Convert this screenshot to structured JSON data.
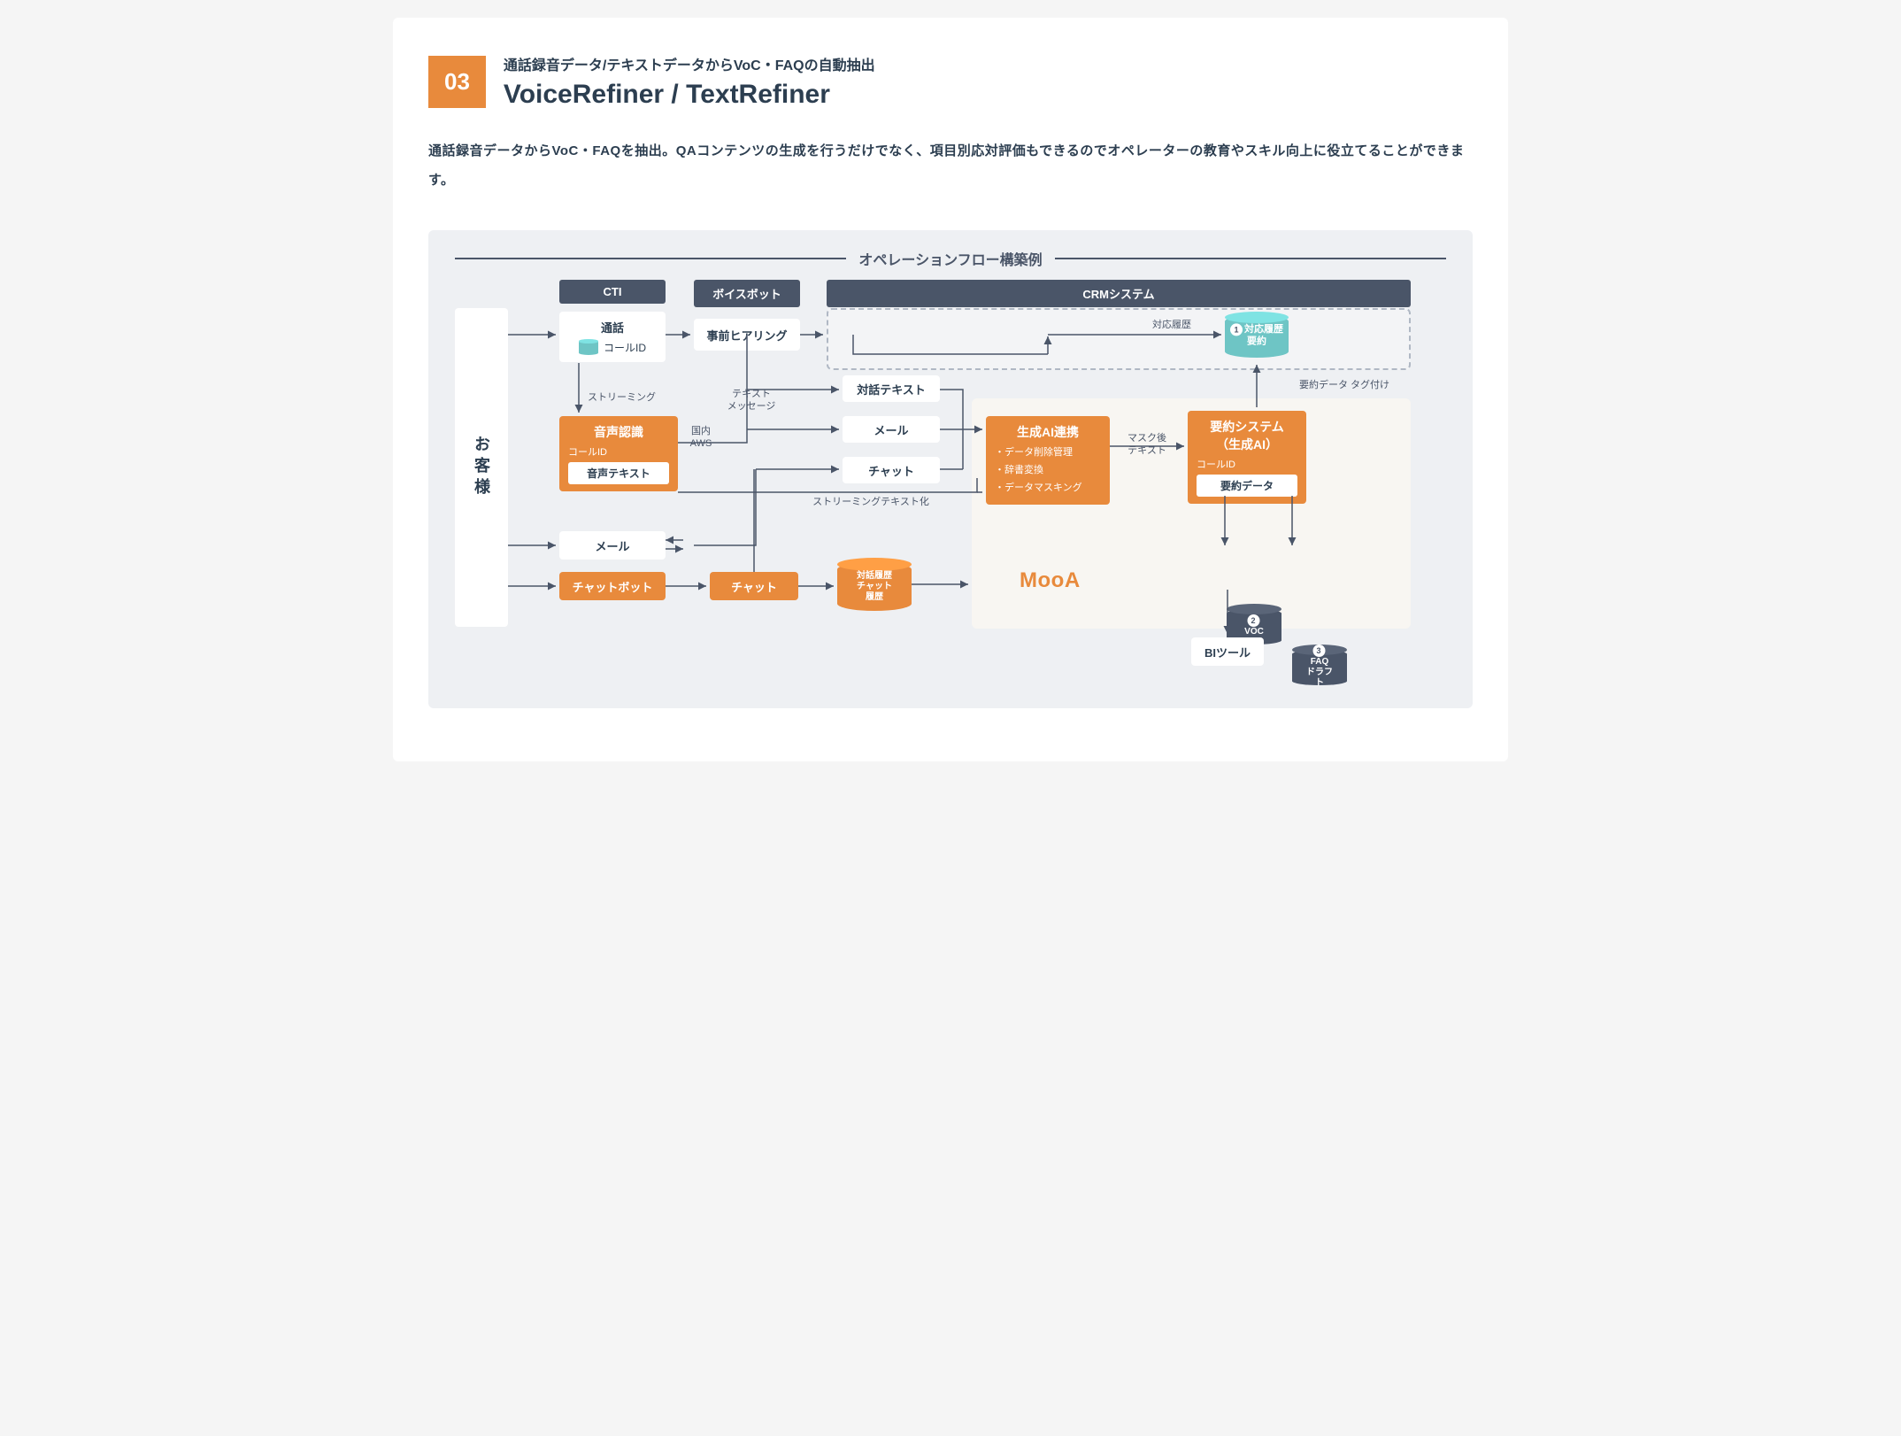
{
  "header": {
    "number": "03",
    "subtitle": "通話録音データ/テキストデータからVoC・FAQの自動抽出",
    "title": "VoiceRefiner / TextRefiner"
  },
  "description": "通話録音データからVoC・FAQを抽出。QAコンテンツの生成を行うだけでなく、項目別応対評価もできるのでオペレーターの教育やスキル向上に役立てることができます。",
  "diagram": {
    "title": "オペレーションフロー構築例",
    "customer": "お客様",
    "headers": {
      "cti": "CTI",
      "voicebot": "ボイスボット",
      "crm": "CRMシステム"
    },
    "call": {
      "title": "通話",
      "id_label": "コールID"
    },
    "prehearing": "事前ヒアリング",
    "streaming": "ストリーミング",
    "text_message": "テキスト\nメッセージ",
    "streaming_text": "ストリーミングテキスト化",
    "asr": {
      "title": "音声認識",
      "sub": "コールID",
      "inner": "音声テキスト"
    },
    "aws": "国内\nAWS",
    "dialog_text": "対話テキスト",
    "mail": "メール",
    "chat": "チャット",
    "mail2": "メール",
    "chatbot": "チャットボット",
    "chat2": "チャット",
    "history_cyl": "対話履歴\nチャット履歴",
    "history_label": "対応履歴",
    "history_summary": {
      "num": "1",
      "l1": "対応履歴",
      "l2": "要約"
    },
    "summary_tag": "要約データ タグ付け",
    "gen_ai": {
      "title": "生成AI連携",
      "b1": "・データ削除管理",
      "b2": "・辞書変換",
      "b3": "・データマスキング"
    },
    "mask_text": "マスク後\nテキスト",
    "summary_sys": {
      "title": "要約システム\n（生成AI）",
      "sub": "コールID",
      "inner": "要約データ"
    },
    "mooa": "MooA",
    "voc": {
      "num": "2",
      "label": "VOC"
    },
    "faq": {
      "num": "3",
      "l1": "FAQ",
      "l2": "ドラフト"
    },
    "bi": "BIツール"
  }
}
